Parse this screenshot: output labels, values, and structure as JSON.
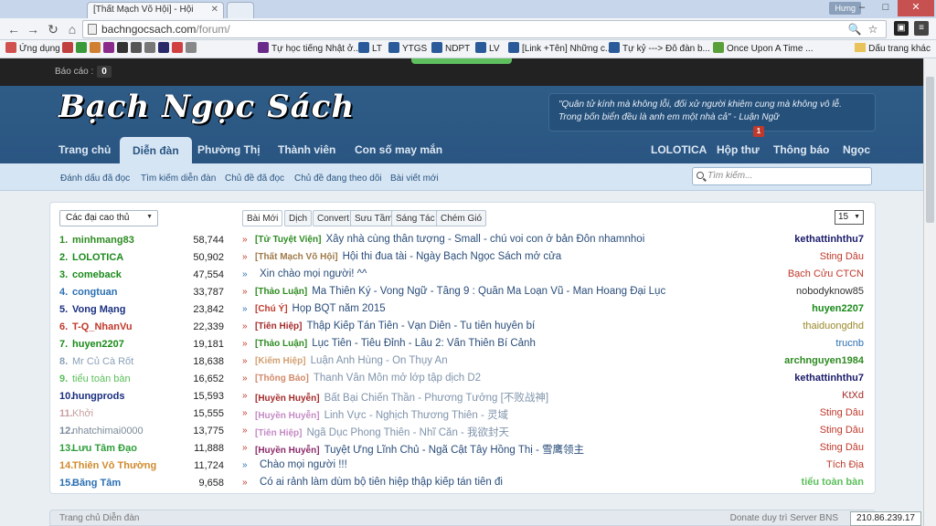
{
  "browser": {
    "tabs": [
      {
        "label": "[Thất Mạch Võ Hội] - Hội"
      }
    ],
    "user": "Hưng",
    "url_domain": "bachngocsach.com",
    "url_path": "/forum/",
    "bookmarks": [
      "Ứng dụng",
      "LT",
      "YTGS",
      "NDPT",
      "LV",
      "[Link +Tên] Những c...",
      "Tự kỷ ---> Đô đàn b...",
      "Once Upon A Time ...",
      "Tự học tiếng Nhật ở..."
    ],
    "bookmarks_folder": "Dấu trang khác"
  },
  "site": {
    "report_label": "Báo cáo :",
    "report_count": "0",
    "logo": "Bạch Ngọc Sách",
    "quote_line1": "\"Quân tử kính mà không lỗi, đối xử người khiêm cung mà không vô lễ.",
    "quote_line2": "Trong bốn biển đều là anh em một nhà cả\" - Luận Ngữ",
    "nav": {
      "home": "Trang chủ",
      "forum": "Diễn đàn",
      "phuongthi": "Phường Thị",
      "members": "Thành viên",
      "stats": "Con số may mắn",
      "user": "LOLOTICA",
      "inbox": "Hộp thư",
      "alerts": "Thông báo",
      "ngoc": "Ngọc",
      "badge": "1"
    },
    "subnav": [
      "Đánh dấu đã đọc",
      "Tìm kiếm diễn đàn",
      "Chủ đề đã đọc",
      "Chủ đề đang theo dõi",
      "Bài viết mới"
    ],
    "search_placeholder": "Tìm kiếm..."
  },
  "leaders": {
    "dropdown": "Các đại cao thủ",
    "items": [
      {
        "num": "1.",
        "name": "minhmang83",
        "pts": "58,744",
        "color": "#2e8b22"
      },
      {
        "num": "2.",
        "name": "LOLOTICA",
        "pts": "50,902",
        "color": "#1a8a1a"
      },
      {
        "num": "3.",
        "name": "comeback",
        "pts": "47,554",
        "color": "#1a8a1a"
      },
      {
        "num": "4.",
        "name": "congtuan",
        "pts": "33,787",
        "color": "#2a6fb2"
      },
      {
        "num": "5.",
        "name": "Vong Mạng",
        "pts": "23,842",
        "color": "#1a2f80"
      },
      {
        "num": "6.",
        "name": "T-Q_NhanVu",
        "pts": "22,339",
        "color": "#c0392b"
      },
      {
        "num": "7.",
        "name": "huyen2207",
        "pts": "19,181",
        "color": "#1a8a1a"
      },
      {
        "num": "8.",
        "name": "Mr Củ Cà Rốt",
        "pts": "18,638",
        "color": "#8aa0b8"
      },
      {
        "num": "9.",
        "name": "tiểu toàn bàn",
        "pts": "16,652",
        "color": "#5bbf5b"
      },
      {
        "num": "10.",
        "name": "hungprods",
        "pts": "15,593",
        "color": "#1a2f80"
      },
      {
        "num": "11.",
        "name": "Khởi",
        "pts": "15,555",
        "color": "#c8a0a0"
      },
      {
        "num": "12.",
        "name": "nhatchimai0000",
        "pts": "13,775",
        "color": "#7a8a9a"
      },
      {
        "num": "13.",
        "name": "Lưu Tâm Đạo",
        "pts": "11,888",
        "color": "#2e9e3a"
      },
      {
        "num": "14.",
        "name": "Thiên Vô Thường",
        "pts": "11,724",
        "color": "#d08a2e"
      },
      {
        "num": "15.",
        "name": "Băng Tâm",
        "pts": "9,658",
        "color": "#2a6fb2"
      }
    ]
  },
  "feed": {
    "tabs": [
      "Bài Mới",
      "Dịch",
      "Convert",
      "Sưu Tầm",
      "Sáng Tác",
      "Chém Gió"
    ],
    "perpage": "15",
    "threads": [
      {
        "arrow": "»",
        "prefix": "[Tử Tuyệt Viện]",
        "pcolor": "#2e8b22",
        "title": "Xây nhà cùng thần tượng - Small - chú voi con ở bản Đôn nhamnhoi",
        "user": "kethattinhthu7",
        "ucolor": "#1a1a6a"
      },
      {
        "arrow": "»",
        "prefix": "[Thất Mạch Võ Hội]",
        "pcolor": "#a07a4a",
        "title": "Hội thi đua tài - Ngày Bạch Ngọc Sách mở cửa",
        "user": "Sting Dâu",
        "ucolor": "#c0392b"
      },
      {
        "arrow": "»",
        "prefix": "",
        "pcolor": "#333",
        "title": "Xin chào mọi người! ^^",
        "user": "Bạch Cửu CTCN",
        "ucolor": "#c0392b"
      },
      {
        "arrow": "»",
        "prefix": "[Thảo Luận]",
        "pcolor": "#2e8b22",
        "title": "Ma Thiên Ký - Vong Ngữ - Tầng 9 : Quần Ma Loạn Vũ - Man Hoang Đại Lục",
        "user": "nobodyknow85",
        "ucolor": "#333"
      },
      {
        "arrow": "»",
        "prefix": "[Chú Ý]",
        "pcolor": "#c0392b",
        "title": "Họp BQT năm 2015",
        "user": "huyen2207",
        "ucolor": "#1a8a1a"
      },
      {
        "arrow": "»",
        "prefix": "[Tiên Hiệp]",
        "pcolor": "#a52a2a",
        "title": "Thập Kiếp Tán Tiên - Vạn Diễn - Tu tiên huyễn bí",
        "user": "thaiduongdhd",
        "ucolor": "#9a8a2a"
      },
      {
        "arrow": "»",
        "prefix": "[Thảo Luận]",
        "pcolor": "#2e8b22",
        "title": "Lục Tiên - Tiêu Đỉnh - Lầu 2: Vấn Thiên Bí Cảnh",
        "user": "trucnb",
        "ucolor": "#2a6fb2"
      },
      {
        "arrow": "»",
        "prefix": "[Kiếm Hiệp]",
        "pcolor": "#d2a070",
        "title": "Luận Anh Hùng - Ôn Thụy An",
        "user": "archnguyen1984",
        "ucolor": "#2e8b22"
      },
      {
        "arrow": "»",
        "prefix": "[Thông Báo]",
        "pcolor": "#d28a6a",
        "title": "Thanh Vân Môn mở lớp tập dịch D2",
        "user": "kethattinhthu7",
        "ucolor": "#1a1a6a"
      },
      {
        "arrow": "»",
        "prefix": "[Huyền Huyễn]",
        "pcolor": "#a52a2a",
        "title": "Bất Bại Chiến Thần - Phương Tưởng [不败战神]",
        "user": "KtXd",
        "ucolor": "#a52a2a"
      },
      {
        "arrow": "»",
        "prefix": "[Huyền Huyễn]",
        "pcolor": "#c48ac4",
        "title": "Linh Vực - Nghịch Thương Thiên - 灵域",
        "user": "Sting Dâu",
        "ucolor": "#c0392b"
      },
      {
        "arrow": "»",
        "prefix": "[Tiên Hiệp]",
        "pcolor": "#c48ac4",
        "title": "Ngã Dục Phong Thiên - Nhĩ Căn - 我欲封天",
        "user": "Sting Dâu",
        "ucolor": "#c0392b"
      },
      {
        "arrow": "»",
        "prefix": "[Huyền Huyễn]",
        "pcolor": "#8a2a6a",
        "title": "Tuyệt Ưng Lĩnh Chủ - Ngã Cật Tây Hồng Thị - 雪鹰领主",
        "user": "Sting Dâu",
        "ucolor": "#c0392b"
      },
      {
        "arrow": "»",
        "prefix": "",
        "pcolor": "#333",
        "title": "Chào mọi người !!!",
        "user": "Tích Địa",
        "ucolor": "#c0392b"
      },
      {
        "arrow": "»",
        "prefix": "",
        "pcolor": "#333",
        "title": "Có ai rảnh làm dùm bộ tiên hiệp thập kiếp tán tiên đi",
        "user": "tiểu toàn bàn",
        "ucolor": "#5bbf5b"
      }
    ]
  },
  "footer": {
    "breadcrumb": "Trang chủ    Diễn đàn",
    "right": "Donate duy trì Server BNS",
    "ip": "210.86.239.17"
  }
}
